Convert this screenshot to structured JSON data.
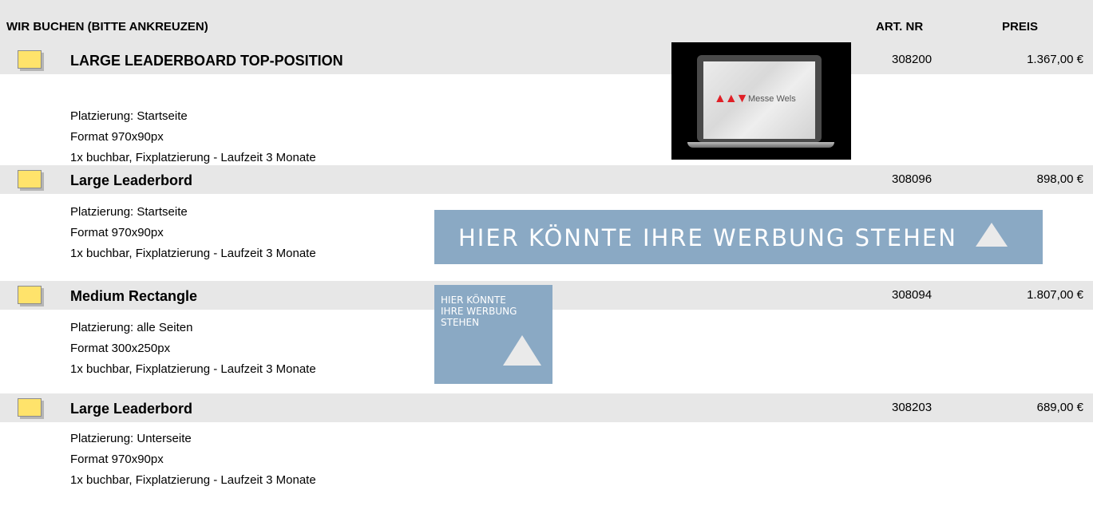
{
  "header": {
    "title": "WIR BUCHEN (BITTE ANKREUZEN)",
    "art_nr": "ART. NR",
    "price": "PREIS"
  },
  "items": [
    {
      "title": "LARGE LEADERBOARD TOP-POSITION",
      "art_nr": "308200",
      "price": "1.367,00 €",
      "details": [
        "Platzierung: Startseite",
        "Format 970x90px",
        "1x buchbar, Fixplatzierung - Laufzeit 3 Monate"
      ],
      "preview": {
        "type": "laptop",
        "logo_mark": "▲▲▼",
        "logo_text": "Messe Wels"
      }
    },
    {
      "title": "Large Leaderbord",
      "art_nr": "308096",
      "price": "898,00 €",
      "details": [
        "Platzierung: Startseite",
        "Format 970x90px",
        "1x buchbar, Fixplatzierung - Laufzeit 3 Monate"
      ],
      "preview": {
        "type": "banner",
        "text": "HIER KÖNNTE IHRE WERBUNG STEHEN"
      }
    },
    {
      "title": "Medium Rectangle",
      "art_nr": "308094",
      "price": "1.807,00 €",
      "details": [
        "Platzierung: alle Seiten",
        "Format 300x250px",
        "1x buchbar, Fixplatzierung - Laufzeit 3 Monate"
      ],
      "preview": {
        "type": "rectangle",
        "lines": [
          "HIER KÖNNTE",
          "IHRE WERBUNG",
          "STEHEN"
        ]
      }
    },
    {
      "title": "Large Leaderbord",
      "art_nr": "308203",
      "price": "689,00 €",
      "details": [
        "Platzierung: Unterseite",
        "Format 970x90px",
        "1x buchbar, Fixplatzierung - Laufzeit 3 Monate"
      ]
    }
  ],
  "colors": {
    "header_bg": "#e7e7e7",
    "checkbox": "#ffe36b",
    "banner_bg": "#8aa9c4",
    "logo_red": "#e01f26"
  }
}
